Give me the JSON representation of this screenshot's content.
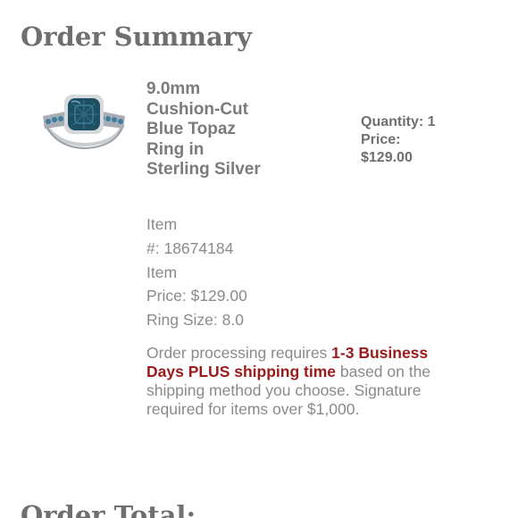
{
  "header": {
    "title": "Order Summary"
  },
  "product": {
    "name": "9.0mm Cushion-Cut Blue Topaz Ring in Sterling Silver",
    "image_icon": "blue-topaz-ring-image",
    "quantity_label": "Quantity: 1",
    "price_label": "Price:",
    "price_value": "$129.00",
    "details": {
      "item_line1": "Item",
      "item_number": "#: 18674184",
      "price_line1": "Item",
      "item_price": "Price: $129.00",
      "ring_size": "Ring Size: 8.0"
    }
  },
  "notice": {
    "prefix": "Order processing requires ",
    "highlight": "1-3 Business Days PLUS shipping time",
    "suffix": " based on the shipping method you choose. Signature required for items over $1,000."
  },
  "totals": {
    "title": "Order Total:"
  },
  "colors": {
    "highlight": "#9b1b1b",
    "heading": "#6f6f6f",
    "gem": "#1f4f63"
  }
}
